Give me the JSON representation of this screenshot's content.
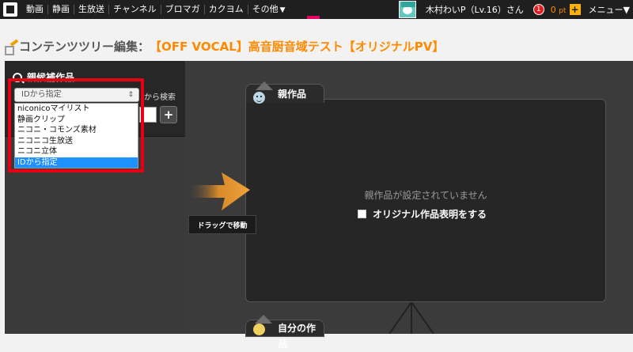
{
  "nav": {
    "items": [
      "動画",
      "静画",
      "生放送",
      "チャンネル",
      "ブロマガ",
      "カクヨム",
      "その他"
    ],
    "more_caret": "▼"
  },
  "user": {
    "name": "木村わいP（Lv.16）さん",
    "notifications": "1",
    "points_value": "0",
    "points_unit": "pt",
    "plus": "+",
    "menu_label": "メニュー▼"
  },
  "page": {
    "title_prefix": "コンテンツツリー編集：",
    "title_work": "【OFF VOCAL】高音厨音域テスト【オリジナルPV】"
  },
  "left": {
    "section_title": "親候補作品",
    "search_suffix": "から検索",
    "add_button": "+",
    "select": {
      "value": "IDから指定",
      "updown": "⇕",
      "options": [
        "niconicoマイリスト",
        "静画クリップ",
        "ニコニ・コモンズ素材",
        "ニコニコ生放送",
        "ニコニ立体",
        "IDから指定"
      ],
      "selected_index": 5
    }
  },
  "drag": {
    "label": "ドラッグで移動"
  },
  "parent": {
    "tab_label": "親作品",
    "empty_text": "親作品が設定されていません",
    "checkbox_label": "オリジナル作品表明をする"
  },
  "own": {
    "tab_label": "自分の作品"
  },
  "colors": {
    "accent": "#ff8a00",
    "highlight": "#e60012",
    "selected": "#1e90ff"
  }
}
